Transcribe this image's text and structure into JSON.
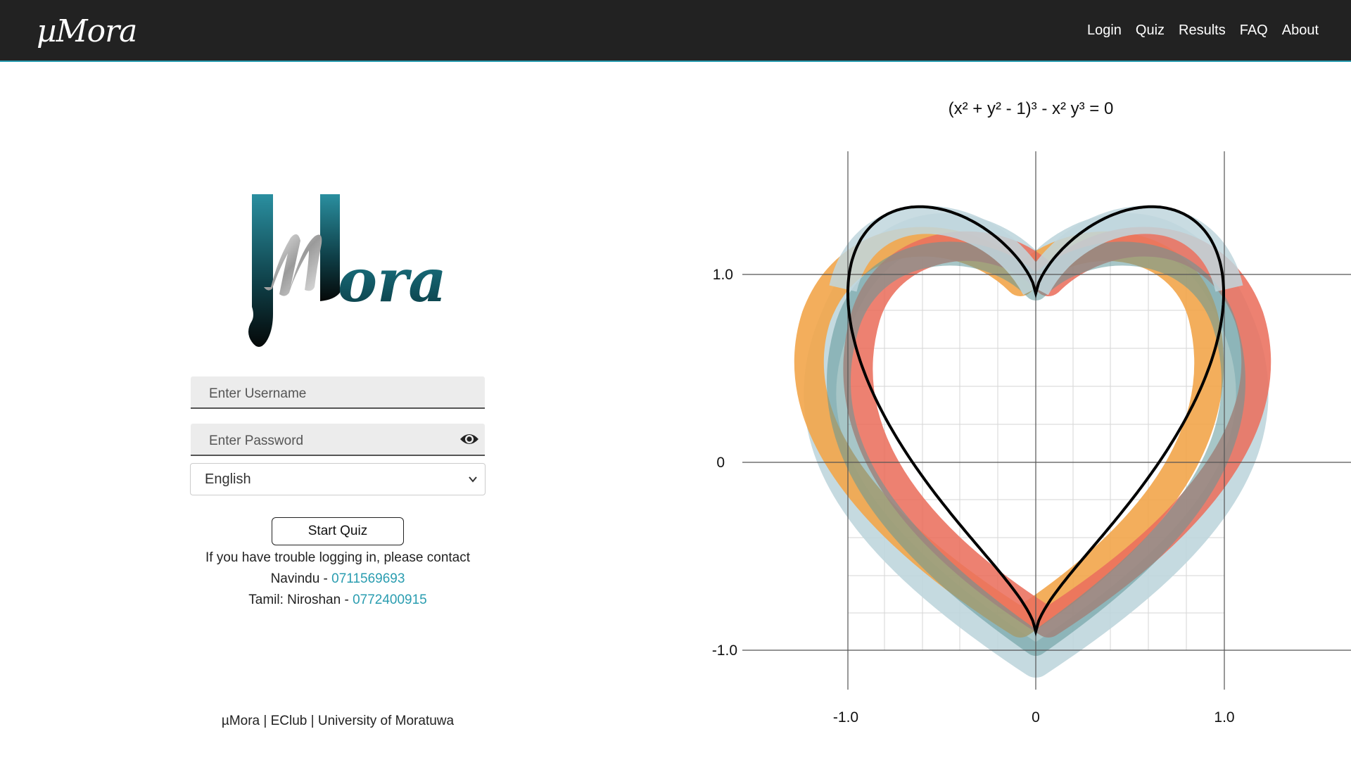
{
  "header": {
    "brand": "µMora",
    "nav": [
      "Login",
      "Quiz",
      "Results",
      "FAQ",
      "About"
    ]
  },
  "logo": {
    "name": "µMora"
  },
  "form": {
    "username_placeholder": "Enter Username",
    "password_placeholder": "Enter Password",
    "language_selected": "English",
    "start_button": "Start Quiz"
  },
  "help": {
    "line1": "If you have trouble logging in, please contact",
    "contact1_name": "Navindu - ",
    "contact1_phone": "0711569693",
    "contact2_name": "Tamil: Niroshan - ",
    "contact2_phone": "0772400915"
  },
  "footer": {
    "text": "µMora | EClub | University of Moratuwa"
  },
  "colors": {
    "accent": "#2a9db0",
    "orange": "#f2a54a",
    "red": "#ea6f5d",
    "teal": "#5e9799",
    "light_blue": "#bfd6dd",
    "topbar": "#222222"
  },
  "icons": {
    "password_toggle": "eye-icon",
    "language_dropdown": "chevron-down-icon"
  },
  "chart_data": {
    "type": "line",
    "title": "(x² + y² - 1)³ - x² y³ = 0",
    "x_ticks": [
      "-1.0",
      "0",
      "1.0"
    ],
    "y_ticks": [
      "1.0",
      "0",
      "-1.0"
    ],
    "xlim": [
      -1.0,
      1.0
    ],
    "ylim": [
      -1.0,
      1.0
    ],
    "grid": true,
    "series": [
      {
        "equation": "(x^2 + y^2 - 1)^3 - x^2 y^3 = 0"
      }
    ]
  }
}
